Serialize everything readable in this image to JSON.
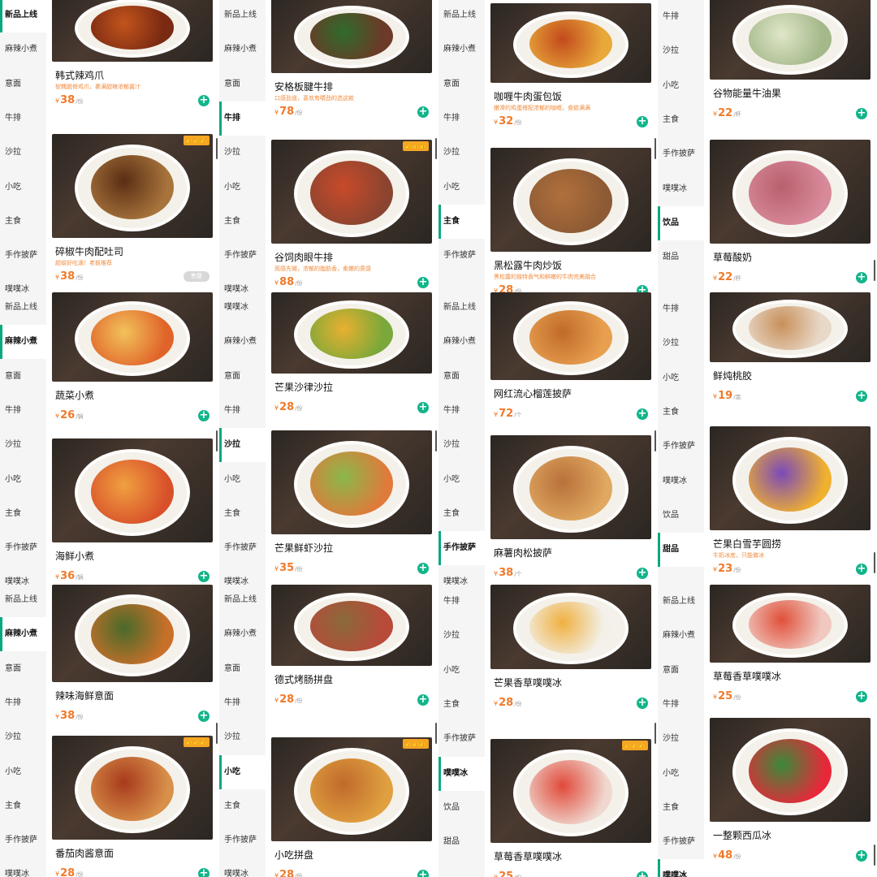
{
  "colors": {
    "accent": "#12b58a",
    "price": "#f07a2a",
    "desc": "#f08a3c",
    "badge": "#f5a623",
    "sidebar": "#f5f5f5"
  },
  "currency": "¥",
  "add_icon": "plus-circle-icon",
  "tiles": [
    {
      "sidebar": [
        "新品上线",
        "麻辣小煮",
        "意面",
        "牛排",
        "沙拉",
        "小吃",
        "主食",
        "手作披萨",
        "噗噗冰"
      ],
      "active": 0,
      "cards": [
        {
          "name": "韩式辣鸡爪",
          "desc": "软糯脱骨鸡爪，裹满甜辣浓郁酱汁",
          "price": "38",
          "unit": "/份",
          "badge": false,
          "c1": "#7a2a12",
          "c2": "#c2541c"
        },
        {
          "name": "碎椒牛肉配吐司",
          "desc": "超级好吃滴！老板推荐",
          "price": "38",
          "unit": "/份",
          "badge": true,
          "soldout": "售罄",
          "c1": "#a8743c",
          "c2": "#5a2e14"
        }
      ]
    },
    {
      "sidebar": [
        "新品上线",
        "麻辣小煮",
        "意面",
        "牛排",
        "沙拉",
        "小吃",
        "主食",
        "手作披萨",
        "噗噗冰"
      ],
      "active": 3,
      "cards": [
        {
          "name": "安格板腱牛排",
          "desc": "口感劲道，喜欢有嚼劲的选这款",
          "price": "78",
          "unit": "/份",
          "badge": false,
          "c1": "#6b3a28",
          "c2": "#2f6b2a"
        },
        {
          "name": "谷饲肉眼牛排",
          "desc": "观感先微，浓郁的脂肪香，柔嫩的质感",
          "price": "88",
          "unit": "/份",
          "badge": true,
          "c1": "#8a4430",
          "c2": "#c84a2a"
        }
      ]
    },
    {
      "sidebar": [
        "新品上线",
        "麻辣小煮",
        "意面",
        "牛排",
        "沙拉",
        "小吃",
        "主食",
        "手作披萨"
      ],
      "active": 6,
      "cards": [
        {
          "name": "咖喱牛肉蛋包饭",
          "desc": "嫩滑的鸡蛋搭配浓郁的咖喱，食欲满满",
          "price": "32",
          "unit": "/份",
          "badge": false,
          "c1": "#e8a83a",
          "c2": "#c24a1c"
        },
        {
          "name": "黑松露牛肉炒饭",
          "desc": "黑松露的独特香气和鲜嫩的牛肉完美融合",
          "price": "28",
          "unit": "/份",
          "badge": false,
          "c1": "#8c5a34",
          "c2": "#b0703c"
        }
      ]
    },
    {
      "sidebar": [
        "牛排",
        "沙拉",
        "小吃",
        "主食",
        "手作披萨",
        "噗噗冰",
        "饮品",
        "甜品"
      ],
      "active": 6,
      "cards": [
        {
          "name": "谷物能量牛油果",
          "price": "22",
          "unit": "/杯",
          "badge": false,
          "c1": "#a4b88a",
          "c2": "#dfe6c8"
        },
        {
          "name": "草莓酸奶",
          "price": "22",
          "unit": "/杯",
          "badge": false,
          "c1": "#d88a9a",
          "c2": "#b8606e"
        }
      ]
    },
    {
      "sidebar": [
        "新品上线",
        "麻辣小煮",
        "意面",
        "牛排",
        "沙拉",
        "小吃",
        "主食",
        "手作披萨",
        "噗噗冰"
      ],
      "active": 1,
      "cards": [
        {
          "name": "蔬菜小煮",
          "price": "26",
          "unit": "/锅",
          "badge": false,
          "c1": "#e0642a",
          "c2": "#f2c25a"
        },
        {
          "name": "海鲜小煮",
          "price": "36",
          "unit": "/锅",
          "badge": false,
          "c1": "#d8502a",
          "c2": "#f0a040"
        }
      ]
    },
    {
      "sidebar": [
        "噗噗冰",
        "麻辣小煮",
        "意面",
        "牛排",
        "沙拉",
        "小吃",
        "主食",
        "手作披萨",
        "噗噗冰"
      ],
      "active": 4,
      "cards": [
        {
          "name": "芒果沙律沙拉",
          "price": "28",
          "unit": "/份",
          "badge": false,
          "c1": "#7aa83a",
          "c2": "#e8b030"
        },
        {
          "name": "芒果鲜虾沙拉",
          "price": "35",
          "unit": "/份",
          "badge": false,
          "c1": "#e07a3a",
          "c2": "#8ab84a"
        }
      ]
    },
    {
      "sidebar": [
        "新品上线",
        "麻辣小煮",
        "意面",
        "牛排",
        "沙拉",
        "小吃",
        "主食",
        "手作披萨",
        "噗噗冰"
      ],
      "active": 7,
      "cards": [
        {
          "name": "网红流心榴莲披萨",
          "price": "72",
          "unit": "/个",
          "badge": false,
          "c1": "#e8a050",
          "c2": "#c06a28"
        },
        {
          "name": "麻薯肉松披萨",
          "price": "38",
          "unit": "/个",
          "badge": false,
          "c1": "#e0a860",
          "c2": "#b8703a"
        }
      ]
    },
    {
      "sidebar": [
        "牛排",
        "沙拉",
        "小吃",
        "主食",
        "手作披萨",
        "噗噗冰",
        "饮品",
        "甜品"
      ],
      "active": 7,
      "cards": [
        {
          "name": "鲜炖桃胶",
          "price": "19",
          "unit": "/盅",
          "badge": false,
          "c1": "#e8d8c8",
          "c2": "#c8905a"
        },
        {
          "name": "芒果白雪芋圆捞",
          "desc": "牛奶冰底，只能做冰",
          "price": "23",
          "unit": "/份",
          "badge": false,
          "c1": "#f0b030",
          "c2": "#7a4ab8"
        }
      ]
    },
    {
      "sidebar": [
        "新品上线",
        "麻辣小煮",
        "意面",
        "牛排",
        "沙拉",
        "小吃",
        "主食",
        "手作披萨",
        "噗噗冰"
      ],
      "active": 1,
      "cards": [
        {
          "name": "辣味海鲜意面",
          "price": "38",
          "unit": "/份",
          "badge": false,
          "c1": "#c8702a",
          "c2": "#4a6a2a"
        },
        {
          "name": "番茄肉酱意面",
          "price": "28",
          "unit": "/份",
          "badge": true,
          "c1": "#d8904a",
          "c2": "#a83a1c"
        }
      ]
    },
    {
      "sidebar": [
        "新品上线",
        "麻辣小煮",
        "意面",
        "牛排",
        "沙拉",
        "小吃",
        "主食",
        "手作披萨",
        "噗噗冰"
      ],
      "active": 5,
      "cards": [
        {
          "name": "德式烤肠拼盘",
          "price": "28",
          "unit": "/份",
          "badge": false,
          "c1": "#b84a3a",
          "c2": "#8a6a3a"
        },
        {
          "name": "小吃拼盘",
          "price": "28",
          "unit": "/份",
          "badge": true,
          "c1": "#e0a040",
          "c2": "#c06a2a"
        }
      ]
    },
    {
      "sidebar": [
        "牛排",
        "沙拉",
        "小吃",
        "主食",
        "手作披萨",
        "噗噗冰",
        "饮品",
        "甜品"
      ],
      "active": 5,
      "cards": [
        {
          "name": "芒果香草噗噗冰",
          "price": "28",
          "unit": "/份",
          "badge": false,
          "c1": "#f2f0e8",
          "c2": "#f0b040"
        },
        {
          "name": "草莓香草噗噗冰",
          "price": "25",
          "unit": "/份",
          "badge": true,
          "c1": "#f0d8d0",
          "c2": "#e04a3a"
        }
      ]
    },
    {
      "sidebar": [
        "新品上线",
        "麻辣小煮",
        "意面",
        "牛排",
        "沙拉",
        "小吃",
        "主食",
        "手作披萨",
        "噗噗冰"
      ],
      "active": 8,
      "cards": [
        {
          "name": "草莓香草噗噗冰",
          "price": "25",
          "unit": "/份",
          "badge": false,
          "c1": "#f0c8c0",
          "c2": "#e0503a"
        },
        {
          "name": "一整颗西瓜冰",
          "price": "48",
          "unit": "/份",
          "badge": false,
          "c1": "#e8283a",
          "c2": "#3a8a3a"
        }
      ]
    }
  ]
}
